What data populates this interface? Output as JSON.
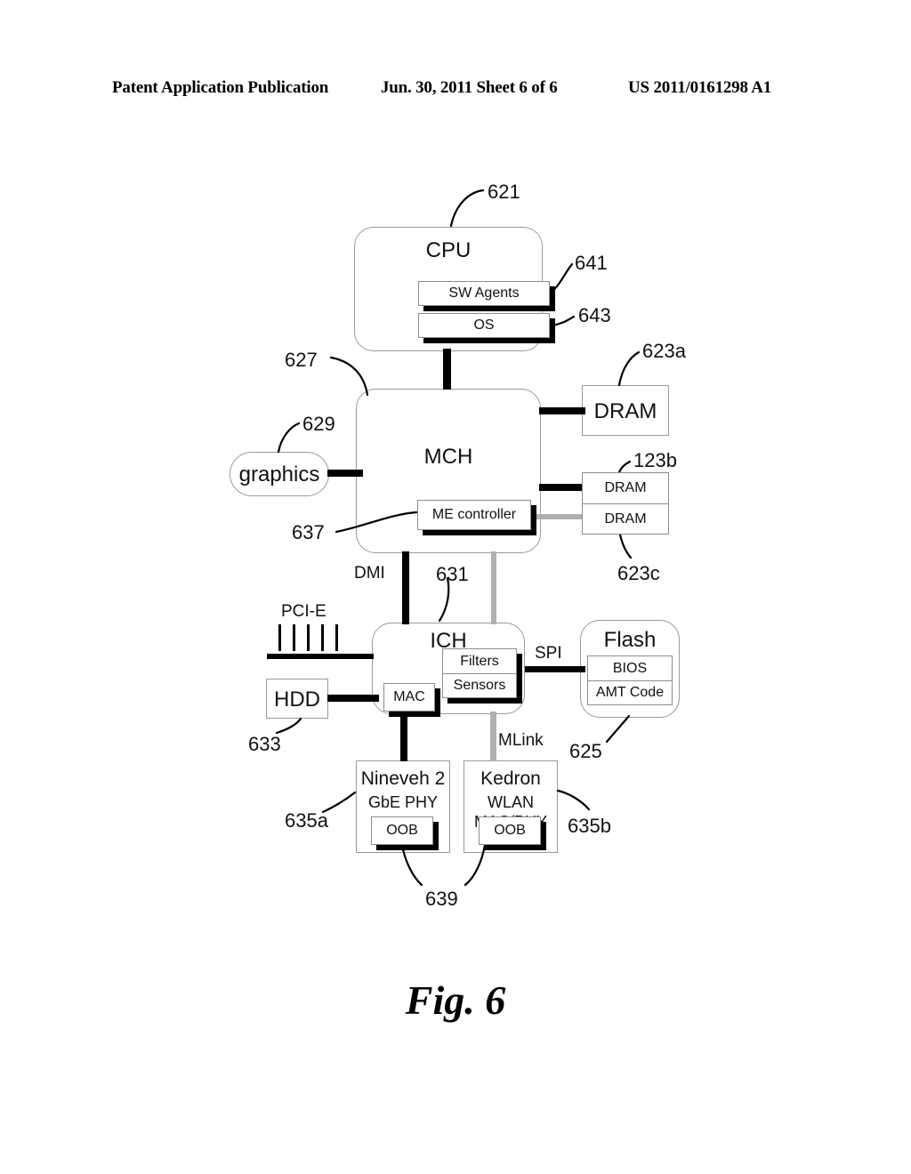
{
  "header": {
    "left": "Patent Application Publication",
    "middle": "Jun. 30, 2011  Sheet 6 of 6",
    "right": "US 2011/0161298 A1"
  },
  "figure": {
    "caption": "Fig. 6"
  },
  "diagram": {
    "blocks": {
      "cpu": {
        "title": "CPU"
      },
      "mch": {
        "title": "MCH"
      },
      "ich": {
        "title": "ICH"
      },
      "graphics": {
        "title": "graphics"
      },
      "flash": {
        "title": "Flash"
      },
      "hdd": {
        "title": "HDD"
      },
      "dram_a": {
        "title": "DRAM"
      },
      "dram_b": {
        "title": "DRAM"
      },
      "dram_c": {
        "title": "DRAM"
      },
      "nineveh": {
        "title": "Nineveh 2",
        "sub": "GbE PHY"
      },
      "kedron": {
        "title": "Kedron",
        "sub1": "WLAN",
        "sub2": "MAC/PHY"
      }
    },
    "subblocks": {
      "sw_agents": "SW Agents",
      "os": "OS",
      "me_controller": "ME controller",
      "filters": "Filters",
      "sensors": "Sensors",
      "mac": "MAC",
      "bios": "BIOS",
      "amt_code": "AMT Code",
      "oob_nineveh": "OOB",
      "oob_kedron": "OOB"
    },
    "bus_labels": {
      "dmi": "DMI",
      "pcie": "PCI-E",
      "spi": "SPI",
      "mlink": "MLink"
    },
    "reference_numerals": {
      "cpu": "621",
      "sw_agents": "641",
      "os": "643",
      "mch": "627",
      "graphics": "629",
      "me_controller": "637",
      "dram_a": "623a",
      "dram_b": "123b",
      "dram_c": "623c",
      "ich": "631",
      "hdd": "633",
      "flash": "625",
      "nineveh": "635a",
      "kedron": "635b",
      "oob": "639"
    },
    "colors": {
      "line": "#000000",
      "gray_line": "#b0b0b0",
      "block_border": "#9a9a9a",
      "background": "#ffffff"
    }
  }
}
